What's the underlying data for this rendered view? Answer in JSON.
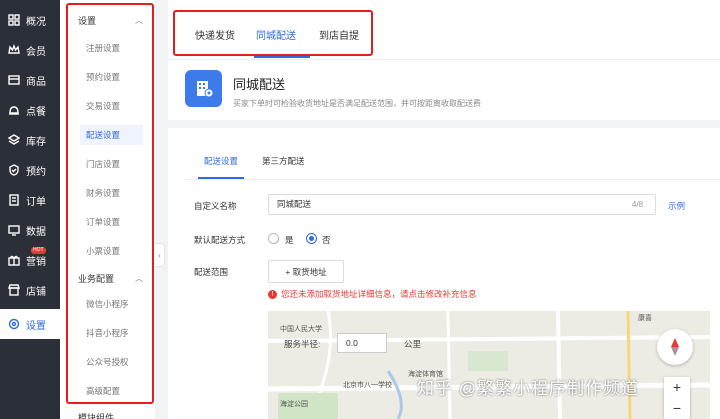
{
  "nav": [
    {
      "label": "概况",
      "icon": "grid-icon"
    },
    {
      "label": "会员",
      "icon": "crown-icon"
    },
    {
      "label": "商品",
      "icon": "box-icon"
    },
    {
      "label": "点餐",
      "icon": "bell-icon"
    },
    {
      "label": "库存",
      "icon": "stack-icon"
    },
    {
      "label": "预约",
      "icon": "check-shield-icon"
    },
    {
      "label": "订单",
      "icon": "doc-icon"
    },
    {
      "label": "数据",
      "icon": "monitor-icon"
    },
    {
      "label": "营销",
      "icon": "gift-icon",
      "badge": "HOT"
    },
    {
      "label": "店铺",
      "icon": "store-icon"
    },
    {
      "label": "设置",
      "icon": "gear-icon",
      "active": true
    }
  ],
  "sub": {
    "section1": "设置",
    "items1": [
      "注册设置",
      "预约设置",
      "交易设置",
      "配送设置",
      "门店设置",
      "财务设置",
      "订单设置",
      "小票设置"
    ],
    "section2": "业务配置",
    "items2": [
      "微信小程序",
      "抖音小程序",
      "公众号授权",
      "高级配置"
    ],
    "more": "模块组件"
  },
  "tabs": [
    "快递发货",
    "同城配送",
    "到店自提"
  ],
  "header": {
    "title": "同城配送",
    "desc": "买家下单时可检验收货地址是否满足配送范围，并可按距离收取配送费"
  },
  "subtabs": [
    "配送设置",
    "第三方配送"
  ],
  "form": {
    "name_label": "自定义名称",
    "name_value": "同城配送",
    "counter": "4/8",
    "example": "示例",
    "default_label": "默认配送方式",
    "yes": "是",
    "no": "否",
    "range_label": "配送范围",
    "add_btn": "+ 取货地址",
    "warning": "您还未添加取货地址详细信息，请点击修改补充信息",
    "radius_label": "服务半径:",
    "radius_value": "0.0",
    "radius_unit": "公里"
  },
  "map": {
    "labels": [
      "北京市八一学校",
      "海淀体育馆",
      "海淀公园",
      "康喜"
    ],
    "poi": "中国人民大学"
  },
  "watermark": "知乎 @繁繁小程序制作频道",
  "colors": {
    "accent": "#2f6bdc",
    "nav_bg": "#2b2f38",
    "highlight": "#e02020"
  }
}
